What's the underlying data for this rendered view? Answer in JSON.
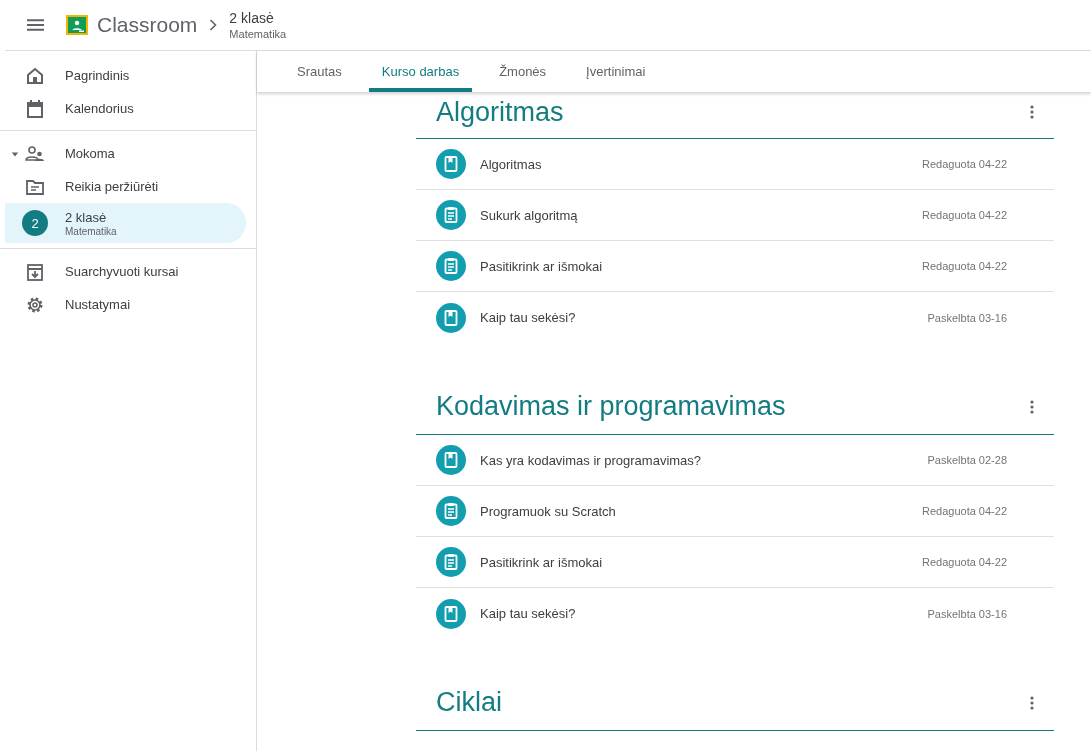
{
  "header": {
    "app_name": "Classroom",
    "breadcrumb_title": "2 klasė",
    "breadcrumb_subtitle": "Matematika"
  },
  "sidebar": {
    "groups": [
      {
        "items": [
          {
            "kind": "home",
            "label": "Pagrindinis",
            "selected": false
          },
          {
            "kind": "calendar",
            "label": "Kalendorius",
            "selected": false
          }
        ]
      },
      {
        "items": [
          {
            "kind": "teaching",
            "label": "Mokoma",
            "expanded": true,
            "selected": false
          },
          {
            "kind": "review",
            "label": "Reikia peržiūrėti",
            "selected": false
          },
          {
            "kind": "class",
            "badge": "2",
            "label": "2 klasė",
            "sublabel": "Matematika",
            "selected": true
          }
        ]
      },
      {
        "items": [
          {
            "kind": "archive",
            "label": "Suarchyvuoti kursai",
            "selected": false
          },
          {
            "kind": "settings",
            "label": "Nustatymai",
            "selected": false
          }
        ]
      }
    ]
  },
  "tabs": [
    {
      "label": "Srautas",
      "selected": false
    },
    {
      "label": "Kurso darbas",
      "selected": true
    },
    {
      "label": "Žmonės",
      "selected": false
    },
    {
      "label": "Įvertinimai",
      "selected": false
    }
  ],
  "topics": [
    {
      "title": "Algoritmas",
      "items": [
        {
          "kind": "material",
          "title": "Algoritmas",
          "date": "Redaguota 04-22"
        },
        {
          "kind": "assignment",
          "title": "Sukurk algoritmą",
          "date": "Redaguota 04-22"
        },
        {
          "kind": "assignment",
          "title": "Pasitikrink ar išmokai",
          "date": "Redaguota 04-22"
        },
        {
          "kind": "material",
          "title": "Kaip tau sekėsi?",
          "date": "Paskelbta 03-16"
        }
      ]
    },
    {
      "title": "Kodavimas ir programavimas",
      "items": [
        {
          "kind": "material",
          "title": "Kas yra kodavimas ir programavimas?",
          "date": "Paskelbta 02-28"
        },
        {
          "kind": "assignment",
          "title": "Programuok su Scratch",
          "date": "Redaguota 04-22"
        },
        {
          "kind": "assignment",
          "title": "Pasitikrink ar išmokai",
          "date": "Redaguota 04-22"
        },
        {
          "kind": "material",
          "title": "Kaip tau sekėsi?",
          "date": "Paskelbta 03-16"
        }
      ]
    },
    {
      "title": "Ciklai"
    }
  ]
}
